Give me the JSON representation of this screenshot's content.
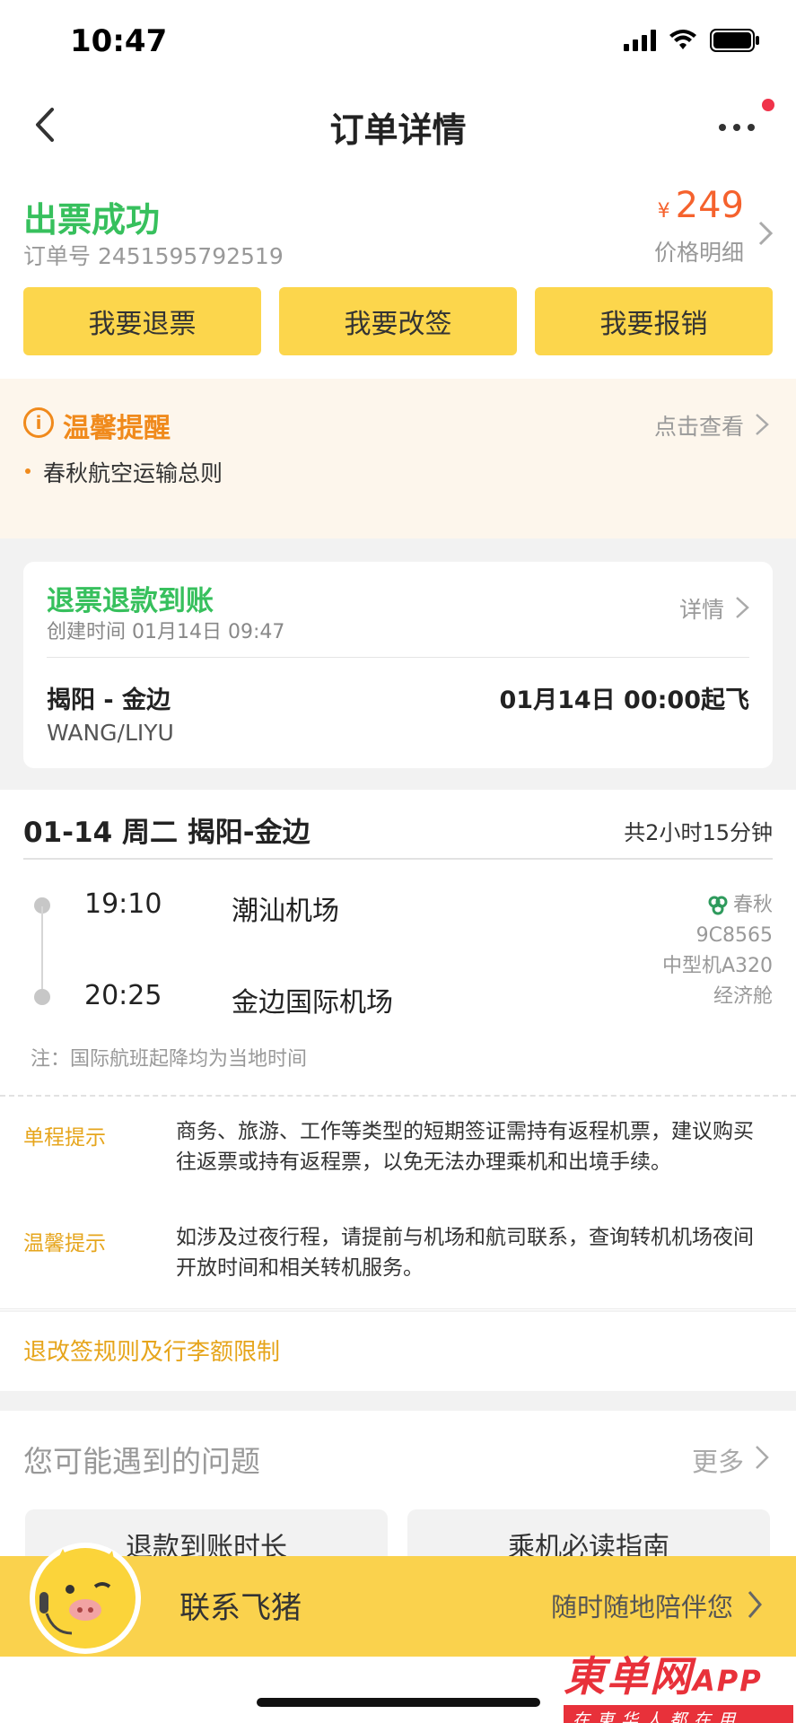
{
  "status_bar": {
    "time": "10:47"
  },
  "nav": {
    "title": "订单详情"
  },
  "order_status": {
    "title": "出票成功",
    "order_no": "订单号 2451595792519",
    "currency": "¥",
    "price": "249",
    "price_detail": "价格明细"
  },
  "actions": [
    {
      "label": "我要退票"
    },
    {
      "label": "我要改签"
    },
    {
      "label": "我要报销"
    }
  ],
  "tips": {
    "title": "温馨提醒",
    "more": "点击查看",
    "items": [
      "春秋航空运输总则"
    ]
  },
  "refund": {
    "title": "退票退款到账",
    "created": "创建时间 01月14日 09:47",
    "detail": "详情",
    "route": "揭阳 - 金边",
    "departure": "01月14日 00:00起飞",
    "passenger": "WANG/LIYU"
  },
  "flight": {
    "date": "01-14 周二 揭阳-金边",
    "duration": "共2小时15分钟",
    "dep_time": "19:10",
    "dep_airport": "潮汕机场",
    "arr_time": "20:25",
    "arr_airport": "金边国际机场",
    "airline": "春秋",
    "flight_no": "9C8565",
    "aircraft": "中型机A320",
    "cabin": "经济舱",
    "note": "注：国际航班起降均为当地时间",
    "hints": [
      {
        "label": "单程提示",
        "text": "商务、旅游、工作等类型的短期签证需持有返程机票，建议购买往返票或持有返程票，以免无法办理乘机和出境手续。"
      },
      {
        "label": "温馨提示",
        "text": "如涉及过夜行程，请提前与机场和航司联系，查询转机机场夜间开放时间和相关转机服务。"
      }
    ]
  },
  "rules": {
    "label": "退改签规则及行李额限制"
  },
  "faq": {
    "title": "您可能遇到的问题",
    "more": "更多",
    "items": [
      "退款到账时长",
      "乘机必读指南"
    ]
  },
  "contact": {
    "label": "联系飞猪",
    "slogan": "随时随地陪伴您"
  },
  "watermark": {
    "main": "東单网",
    "app": "APP",
    "sub": "在東华人都在用"
  },
  "colors": {
    "accent_yellow": "#fcd64c",
    "success_green": "#37c05d",
    "price_orange": "#f5622d",
    "tip_orange": "#f08a1c",
    "hint_gold": "#e6a51c"
  }
}
